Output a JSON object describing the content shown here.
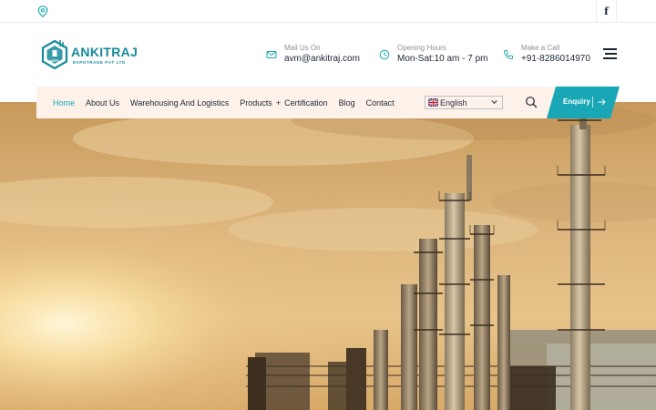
{
  "topbar": {
    "location_icon": "map-pin-icon",
    "social_facebook": "f"
  },
  "brand": {
    "name": "ANKITRAJ",
    "tagline": "EXPOTRADE PVT LTD",
    "emblem_text": "AEPL",
    "color": "#168a9a"
  },
  "contact": {
    "mail": {
      "label": "Mail Us On",
      "value": "avm@ankitraj.com",
      "icon": "envelope-icon"
    },
    "hours": {
      "label": "Opening Hours",
      "value": "Mon-Sat:10 am - 7 pm",
      "icon": "clock-icon"
    },
    "call": {
      "label": "Make a Call",
      "value": "+91-8286014970",
      "icon": "phone-icon"
    }
  },
  "nav": {
    "items": [
      {
        "label": "Home",
        "active": true
      },
      {
        "label": "About Us"
      },
      {
        "label": "Warehousing And Logistics"
      },
      {
        "label": "Products",
        "submenu_marker": "+"
      },
      {
        "label": "Certification"
      },
      {
        "label": "Blog"
      },
      {
        "label": "Contact"
      }
    ],
    "language": {
      "selected": "English",
      "flag": "uk-flag-icon"
    },
    "search_icon": "search-icon",
    "enquiry_label": "Enquiry",
    "enquiry_separator": "|"
  },
  "colors": {
    "accent": "#19a7b6",
    "nav_bg": "#fdf2ea",
    "text": "#1d2634"
  }
}
